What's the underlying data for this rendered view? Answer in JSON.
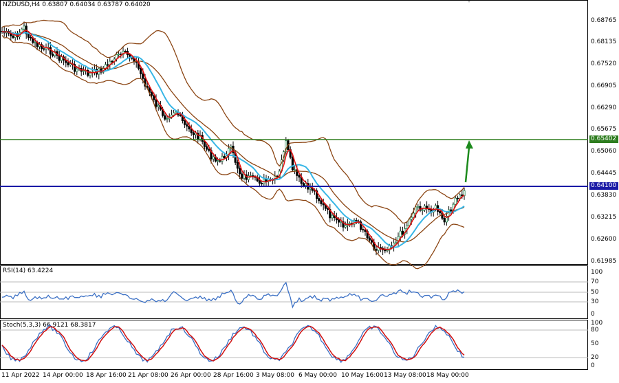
{
  "chart": {
    "symbol_header": "NZDUSD,H4  0.63807 0.64034 0.63787 0.64020"
  },
  "price_axis": {
    "ticks": [
      "0.68765",
      "0.68135",
      "0.67520",
      "0.66905",
      "0.66290",
      "0.65675",
      "0.65060",
      "0.64445",
      "0.63830",
      "0.63215",
      "0.62600",
      "0.61985"
    ]
  },
  "levels": {
    "green_level": "0.65402",
    "blue_level": "0.64100",
    "current_price": "0.64020"
  },
  "rsi": {
    "header": "RSI(14) 63.4224",
    "ticks": [
      "100",
      "70",
      "50",
      "30",
      "0"
    ]
  },
  "stoch": {
    "header": "Stoch(5,3,3) 66.9121 68.3817",
    "ticks": [
      "100",
      "80",
      "50",
      "20",
      "0"
    ]
  },
  "time_axis": {
    "labels": [
      "11 Apr 2022",
      "14 Apr 00:00",
      "18 Apr 16:00",
      "21 Apr 08:00",
      "26 Apr 00:00",
      "28 Apr 16:00",
      "3 May 08:00",
      "6 May 00:00",
      "10 May 16:00",
      "13 May 08:00",
      "18 May 00:00"
    ]
  },
  "colors": {
    "bull_candle": "#2e8b57",
    "bear_candle": "#000000",
    "ma_fast": "#e01010",
    "ma_slow": "#37b6e6",
    "bands": "#8b4513",
    "green_line": "#2e7d1f",
    "blue_line": "#1a1aa6",
    "arrow": "#1c8a1c",
    "rsi_line": "#3a6fc4",
    "stoch_main": "#3a6fc4",
    "stoch_signal": "#d01010"
  }
}
